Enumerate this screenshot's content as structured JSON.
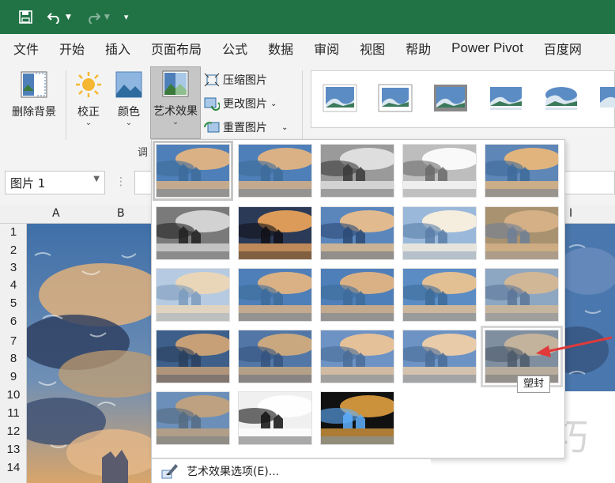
{
  "quick_access": {
    "icons": [
      "save-icon",
      "undo-icon",
      "redo-icon",
      "customize-icon"
    ]
  },
  "menu": {
    "tabs": [
      "文件",
      "开始",
      "插入",
      "页面布局",
      "公式",
      "数据",
      "审阅",
      "视图",
      "帮助",
      "Power Pivot",
      "百度网"
    ]
  },
  "ribbon": {
    "remove_bg": "删除背景",
    "corrections": "校正",
    "color": "颜色",
    "artistic": "艺术效果",
    "compress": "压缩图片",
    "change": "更改图片",
    "reset": "重置图片",
    "group_label": "调"
  },
  "name_box": {
    "value": "图片 1"
  },
  "columns": [
    "A",
    "B",
    "I"
  ],
  "rows": [
    "1",
    "2",
    "3",
    "4",
    "5",
    "6",
    "7",
    "8",
    "9",
    "10",
    "11",
    "12",
    "13",
    "14"
  ],
  "tooltip": "塑封",
  "footer_option": "艺术效果选项(E)...",
  "watermark": "软件技巧",
  "colors": {
    "excel_green": "#217346",
    "sky": "#4f7fb8",
    "arrow": "#e03a3a"
  }
}
